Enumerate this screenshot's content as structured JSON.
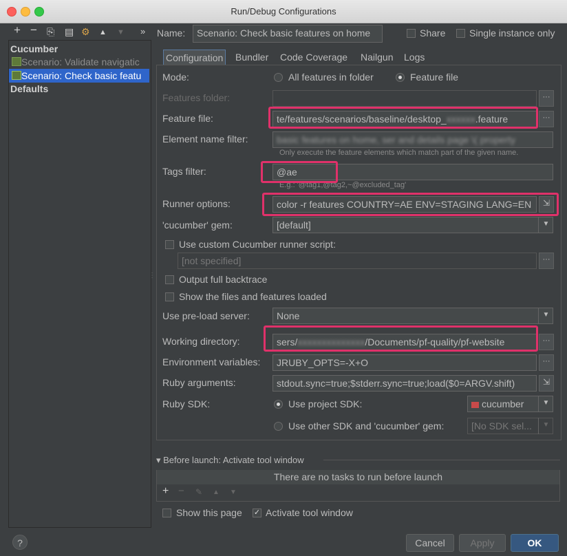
{
  "window": {
    "title": "Run/Debug Configurations"
  },
  "toolbar": {
    "add": "+",
    "remove": "−",
    "copy": "⎘",
    "save": "▤",
    "edit": "⚙",
    "up": "▲",
    "down": "▼",
    "more": "»"
  },
  "tree": {
    "group": "Cucumber",
    "items": [
      "Scenario: Validate navigatic",
      "Scenario: Check basic featu"
    ],
    "defaults": "Defaults"
  },
  "name": {
    "label": "Name:",
    "value": "Scenario: Check basic features on home"
  },
  "share": {
    "label": "Share"
  },
  "single_instance": {
    "label": "Single instance only"
  },
  "tabs": [
    "Configuration",
    "Bundler",
    "Code Coverage",
    "Nailgun",
    "Logs"
  ],
  "form": {
    "mode_label": "Mode:",
    "mode_all": "All features in folder",
    "mode_file": "Feature file",
    "features_folder_label": "Features folder:",
    "feature_file_label": "Feature file:",
    "feature_file_value": "te/features/scenarios/baseline/desktop_",
    "feature_file_blur": "xxxxxx",
    "feature_file_ext": ".feature",
    "element_filter_label": "Element name filter:",
    "element_filter_value": "basic features on home, ser and details page \\( property",
    "element_filter_hint": "Only execute the feature elements which match part of the given name.",
    "tags_label": "Tags filter:",
    "tags_value": "@ae",
    "tags_hint": "E.g.: '@tag1,@tag2,~@excluded_tag'",
    "runner_label": "Runner options:",
    "runner_value": "color -r features COUNTRY=AE ENV=STAGING LANG=EN",
    "gem_label": "'cucumber' gem:",
    "gem_value": "[default]",
    "custom_runner_label": "Use custom Cucumber runner script:",
    "custom_runner_value": "[not specified]",
    "backtrace_label": "Output full backtrace",
    "show_files_label": "Show the files and features loaded",
    "preload_label": "Use pre-load server:",
    "preload_value": "None",
    "workdir_label": "Working directory:",
    "workdir_prefix": "sers/",
    "workdir_blur": "xxxxxxxxxxxxxx",
    "workdir_suffix": "/Documents/pf-quality/pf-website",
    "env_label": "Environment variables:",
    "env_value": "JRUBY_OPTS=-X+O",
    "ruby_args_label": "Ruby arguments:",
    "ruby_args_value": "stdout.sync=true;$stderr.sync=true;load($0=ARGV.shift)",
    "sdk_label": "Ruby SDK:",
    "sdk_project": "Use project SDK:",
    "sdk_project_value": "cucumber",
    "sdk_other": "Use other SDK and 'cucumber' gem:",
    "sdk_other_value": "[No SDK sel..."
  },
  "before_launch": {
    "header": "Before launch: Activate tool window",
    "empty": "There are no tasks to run before launch"
  },
  "bottom": {
    "show_page": "Show this page",
    "activate_tool": "Activate tool window",
    "help": "?",
    "cancel": "Cancel",
    "apply": "Apply",
    "ok": "OK"
  },
  "colors": {
    "highlight": "#e0316a",
    "selection": "#2f65ca",
    "ok_blue": "#3a76d0"
  }
}
